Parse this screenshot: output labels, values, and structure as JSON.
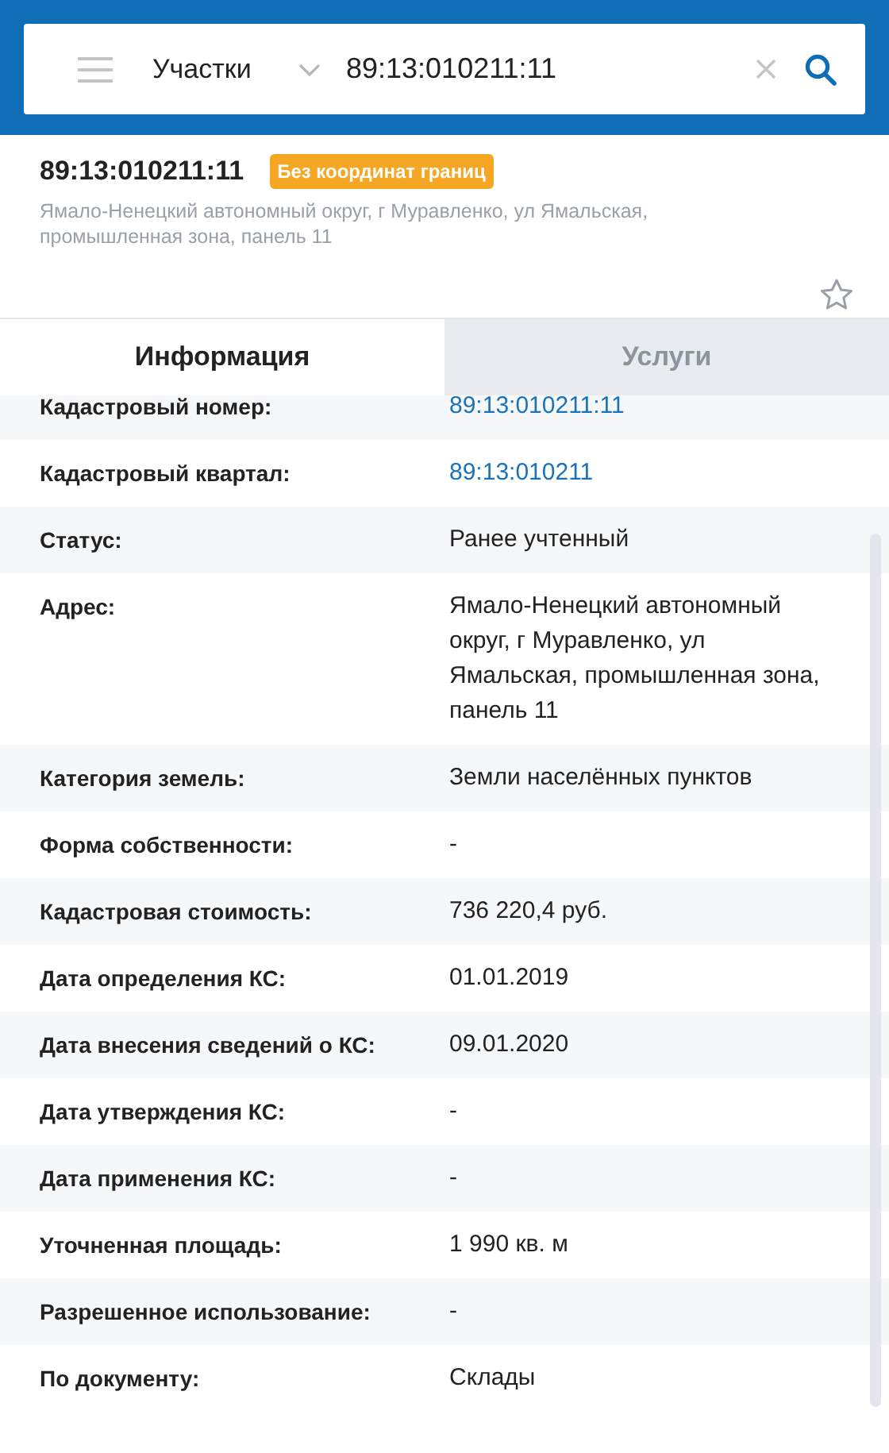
{
  "search": {
    "category": "Участки",
    "value": "89:13:010211:11"
  },
  "object": {
    "number": "89:13:010211:11",
    "badge": "Без координат границ",
    "address": "Ямало-Ненецкий автономный округ, г Муравленко, ул Ямальская, промышленная зона, панель 11",
    "favorite": false
  },
  "tabs": [
    {
      "label": "Информация",
      "selected": true
    },
    {
      "label": "Услуги",
      "selected": false
    }
  ],
  "rows": [
    {
      "label": "Кадастровый номер:",
      "value": "89:13:010211:11",
      "kind": "link"
    },
    {
      "label": "Кадастровый квартал:",
      "value": "89:13:010211",
      "kind": "link"
    },
    {
      "label": "Статус:",
      "value": "Ранее учтенный",
      "kind": "text"
    },
    {
      "label": "Адрес:",
      "value": "Ямало-Ненецкий автономный округ, г Муравленко, ул Ямальская, промышленная зона, панель 11",
      "kind": "text"
    },
    {
      "label": "Категория земель:",
      "value": "Земли населённых пунктов",
      "kind": "text"
    },
    {
      "label": "Форма собственности:",
      "value": "-",
      "kind": "text"
    },
    {
      "label": "Кадастровая стоимость:",
      "value": "736 220,4 руб.",
      "kind": "text"
    },
    {
      "label": "Дата определения КС:",
      "value": "01.01.2019",
      "kind": "text"
    },
    {
      "label": "Дата внесения сведений о КС:",
      "value": "09.01.2020",
      "kind": "text"
    },
    {
      "label": "Дата утверждения КС:",
      "value": "-",
      "kind": "text"
    },
    {
      "label": "Дата применения КС:",
      "value": "-",
      "kind": "text"
    },
    {
      "label": "Уточненная площадь:",
      "value": "1 990 кв. м",
      "kind": "text"
    },
    {
      "label": "Разрешенное использование:",
      "value": "-",
      "kind": "text"
    },
    {
      "label": "По документу:",
      "value": "Склады",
      "kind": "text"
    }
  ]
}
